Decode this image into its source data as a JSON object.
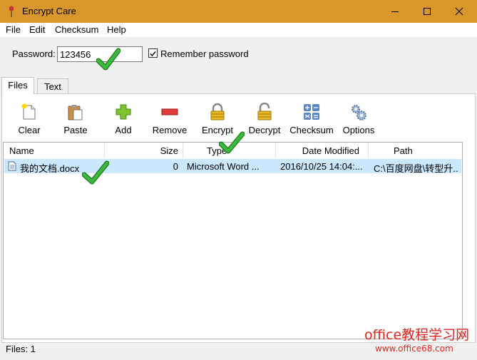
{
  "window": {
    "title": "Encrypt Care"
  },
  "menu": [
    "File",
    "Edit",
    "Checksum",
    "Help"
  ],
  "password": {
    "label": "Password:",
    "value": "123456"
  },
  "remember": {
    "label": "Remember password",
    "checked": true
  },
  "tabs": [
    {
      "label": "Files",
      "active": true
    },
    {
      "label": "Text",
      "active": false
    }
  ],
  "toolbar": [
    {
      "label": "Clear",
      "icon": "clear-icon"
    },
    {
      "label": "Paste",
      "icon": "paste-icon"
    },
    {
      "label": "Add",
      "icon": "add-icon"
    },
    {
      "label": "Remove",
      "icon": "remove-icon"
    },
    {
      "label": "Encrypt",
      "icon": "lock-closed-icon"
    },
    {
      "label": "Decrypt",
      "icon": "lock-open-icon"
    },
    {
      "label": "Checksum",
      "icon": "calculator-icon"
    },
    {
      "label": "Options",
      "icon": "gears-icon"
    }
  ],
  "columns": [
    "Name",
    "Size",
    "Type",
    "Date Modified",
    "Path"
  ],
  "rows": [
    {
      "name": "我的文档.docx",
      "size": "0",
      "type": "Microsoft Word ...",
      "date": "2016/10/25 14:04:...",
      "path": "C:\\百度网盘\\转型升..."
    }
  ],
  "status": "Files: 1",
  "watermark": {
    "line1": "office教程学习网",
    "line2": "www.office68.com"
  },
  "colors": {
    "titlebar": "#d9962a",
    "selection": "#cce8ff",
    "checkmark": "#2aa12a",
    "watermark": "#e0241b"
  }
}
